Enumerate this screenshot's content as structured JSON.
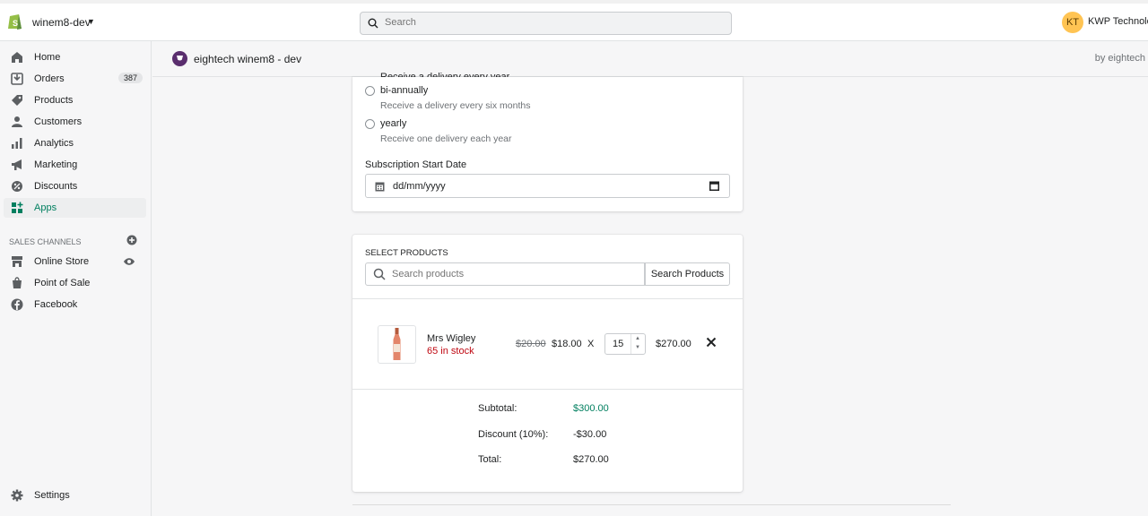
{
  "topbar": {
    "store_name": "winem8-dev",
    "search_placeholder": "Search",
    "avatar_initials": "KT",
    "account_name": "KWP Technolog"
  },
  "sidebar": {
    "items": [
      {
        "label": "Home"
      },
      {
        "label": "Orders",
        "badge": "387"
      },
      {
        "label": "Products"
      },
      {
        "label": "Customers"
      },
      {
        "label": "Analytics"
      },
      {
        "label": "Marketing"
      },
      {
        "label": "Discounts"
      },
      {
        "label": "Apps",
        "active": true
      }
    ],
    "sales_channels_heading": "SALES CHANNELS",
    "channels": [
      {
        "label": "Online Store"
      },
      {
        "label": "Point of Sale"
      },
      {
        "label": "Facebook"
      }
    ],
    "settings_label": "Settings"
  },
  "app_header": {
    "title": "eightech winem8 - dev",
    "by": "by eightech"
  },
  "frequency": {
    "clipped_text": "Receive a delivery every year",
    "options": [
      {
        "label": "bi-annually",
        "help": "Receive a delivery every six months"
      },
      {
        "label": "yearly",
        "help": "Receive one delivery each year"
      }
    ]
  },
  "start_date": {
    "label": "Subscription Start Date",
    "placeholder": "dd/mm/yyyy"
  },
  "select_products": {
    "title": "SELECT PRODUCTS",
    "search_placeholder": "Search products",
    "search_button": "Search Products"
  },
  "line_item": {
    "name": "Mrs Wigley",
    "stock": "65 in stock",
    "original_price": "$20.00",
    "price": "$18.00",
    "times": "X",
    "quantity": "15",
    "line_total": "$270.00"
  },
  "summary": {
    "subtotal_label": "Subtotal:",
    "subtotal": "$300.00",
    "discount_label": "Discount (10%):",
    "discount": "-$30.00",
    "total_label": "Total:",
    "total": "$270.00"
  },
  "colors": {
    "accent_green": "#007f5f",
    "stock_red": "#bf0711",
    "avatar_bg": "#ffc453"
  }
}
